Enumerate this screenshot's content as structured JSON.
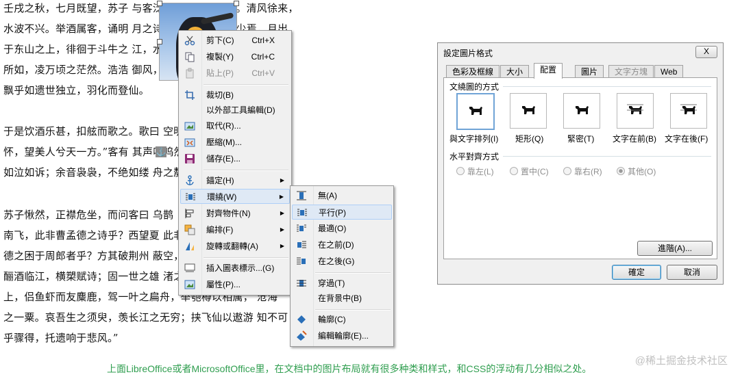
{
  "document": {
    "lines": [
      "壬戌之秋，七月既望，苏子                    与客泛舟游于赤壁之下。清风徐来，",
      "水波不兴。举酒属客，诵明                    月之诗，歌窈窕之章。少焉，月出",
      "于东山之上，徘徊于斗牛之                    江，水光接天。纵一苇之",
      "所如，凌万顷之茫然。浩浩                    御风，而不知其所止；飘",
      "飘乎如遗世独立，羽化而登仙。",
      "",
      "于是饮酒乐甚，扣舷而歌之。歌曰                  空明兮溯流光。渺渺兮于",
      "怀，望美人兮天一方。”客有                  其声呜呜然：如怨如慕，",
      "如泣如诉；余音袅袅，不绝如缕                  舟之嫠妇。",
      "",
      "苏子愀然，正襟危坐，而问客曰                                          乌鹊",
      "南飞，此非曹孟德之诗乎？西望夏                                          此非孟",
      "德之困于周郎者乎？方其破荆州                                          蔽空，",
      "酾酒临江，横槊赋诗；固一世之雄                                          渚之",
      "上，侣鱼虾而友麋鹿，驾一叶之扁舟，举匏樽以相属，                          沧海",
      "之一粟。哀吾生之须臾，羡长江之无穷；挟飞仙以遨游                          知不可",
      "乎骤得，托遗响于悲风。”"
    ],
    "anchor_glyph": "⚓"
  },
  "context_menu": {
    "items": [
      {
        "label": "剪下(C)",
        "shortcut": "Ctrl+X",
        "icon": "scissors-icon",
        "disabled": false
      },
      {
        "label": "複製(Y)",
        "shortcut": "Ctrl+C",
        "icon": "copy-icon",
        "disabled": false
      },
      {
        "label": "貼上(P)",
        "shortcut": "Ctrl+V",
        "icon": "paste-icon",
        "disabled": true
      },
      {
        "label": "裁切(B)",
        "icon": "crop-icon"
      },
      {
        "label": "以外部工具編輯(D)",
        "icon": ""
      },
      {
        "label": "取代(R)...",
        "icon": "replace-image-icon"
      },
      {
        "label": "壓縮(M)...",
        "icon": "compress-icon"
      },
      {
        "label": "儲存(E)...",
        "icon": "save-icon"
      },
      {
        "label": "錨定(H)",
        "icon": "anchor-icon",
        "submenu": true
      },
      {
        "label": "環繞(W)",
        "icon": "wrap-icon",
        "submenu": true,
        "highlighted": true
      },
      {
        "label": "對齊物件(N)",
        "icon": "align-icon",
        "submenu": true
      },
      {
        "label": "編排(F)",
        "icon": "arrange-icon",
        "submenu": true
      },
      {
        "label": "旋轉或翻轉(A)",
        "icon": "rotate-icon",
        "submenu": true
      },
      {
        "label": "插入圖表標示...(G)",
        "icon": "caption-icon"
      },
      {
        "label": "屬性(P)...",
        "icon": "properties-icon"
      }
    ]
  },
  "wrap_submenu": {
    "items": [
      {
        "label": "無(A)",
        "icon": "wrap-none-icon"
      },
      {
        "label": "平行(P)",
        "icon": "wrap-parallel-icon",
        "selected": true
      },
      {
        "label": "最適(O)",
        "icon": "wrap-optimal-icon"
      },
      {
        "label": "在之前(D)",
        "icon": "wrap-before-icon"
      },
      {
        "label": "在之後(G)",
        "icon": "wrap-after-icon"
      },
      {
        "label": "穿過(T)",
        "icon": "wrap-through-icon"
      },
      {
        "label": "在背景中(B)",
        "icon": ""
      },
      {
        "label": "輪廓(C)",
        "icon": "contour-icon"
      },
      {
        "label": "編輯輪廓(E)...",
        "icon": "edit-contour-icon"
      }
    ]
  },
  "dialog": {
    "title": "設定圖片格式",
    "close_label": "X",
    "tabs": [
      "色彩及框線",
      "大小",
      "配置",
      "圖片",
      "文字方塊",
      "Web"
    ],
    "active_tab": "配置",
    "wrap_group_label": "文繞圖的方式",
    "wrap_options": [
      "與文字排列(I)",
      "矩形(Q)",
      "緊密(T)",
      "文字在前(B)",
      "文字在後(F)"
    ],
    "align_group_label": "水平對齊方式",
    "align_options": [
      "靠左(L)",
      "置中(C)",
      "靠右(R)",
      "其他(O)"
    ],
    "advanced_button": "進階(A)...",
    "ok_button": "確定",
    "cancel_button": "取消"
  },
  "caption": "上面LibreOffice或者MicrosoftOffice里，在文档中的图片布局就有很多种类和样式，和CSS的浮动有几分相似之处。",
  "watermark": "@稀土掘金技术社区",
  "colors": {
    "caption": "#2f9e4f",
    "menu_highlight": "#dfe9f5",
    "dialog_bg": "#f0f0f0"
  }
}
